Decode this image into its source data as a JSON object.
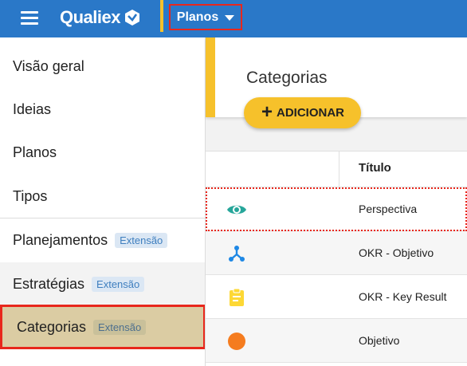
{
  "topbar": {
    "brand": "Qualiex",
    "menu_button": "Planos"
  },
  "sidebar": {
    "items": [
      {
        "label": "Visão geral"
      },
      {
        "label": "Ideias"
      },
      {
        "label": "Planos"
      },
      {
        "label": "Tipos"
      },
      {
        "label": "Planejamentos",
        "badge": "Extensão"
      },
      {
        "label": "Estratégias",
        "badge": "Extensão"
      },
      {
        "label": "Categorias",
        "badge": "Extensão"
      }
    ]
  },
  "main": {
    "title": "Categorias",
    "add_label": "ADICIONAR",
    "table": {
      "header_title": "Título",
      "rows": [
        {
          "icon": "eye-icon",
          "color": "#26a69a",
          "title": "Perspectiva"
        },
        {
          "icon": "hierarchy-icon",
          "color": "#1e88e5",
          "title": "OKR - Objetivo"
        },
        {
          "icon": "clipboard-icon",
          "color": "#fdd835",
          "title": "OKR - Key Result"
        },
        {
          "icon": "circle-icon",
          "color": "#f57c1f",
          "title": "Objetivo"
        }
      ]
    }
  }
}
